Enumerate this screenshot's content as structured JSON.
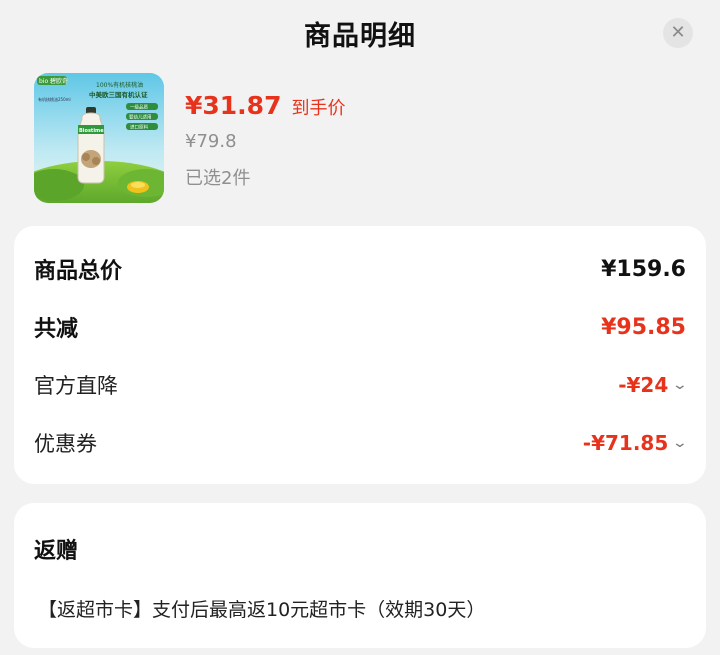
{
  "header": {
    "title": "商品明细",
    "close_icon": "close-icon"
  },
  "product": {
    "image_icon": "product-image",
    "image_text": {
      "brand": "bio 碧欧奇",
      "headline1": "100%有机核桃油",
      "headline2": "中美欧三国有机认证",
      "size": "有机核桃油250ml",
      "badge1": "一级品质",
      "badge2": "婴幼儿适用",
      "badge3": "进口原料",
      "bottle_label": "Biostime"
    },
    "price": "¥31.87",
    "price_tag": "到手价",
    "original_price": "¥79.8",
    "selected_count": "已选2件"
  },
  "summary": {
    "total_label": "商品总价",
    "total_value": "¥159.6",
    "discount_label": "共减",
    "discount_value": "¥95.85",
    "items": [
      {
        "label": "官方直降",
        "value": "-¥24"
      },
      {
        "label": "优惠券",
        "value": "-¥71.85"
      }
    ]
  },
  "rebate": {
    "title": "返赠",
    "text": "【返超市卡】支付后最高返10元超市卡（效期30天）"
  },
  "colors": {
    "accent": "#e8331c",
    "background": "#f2f2f2"
  }
}
